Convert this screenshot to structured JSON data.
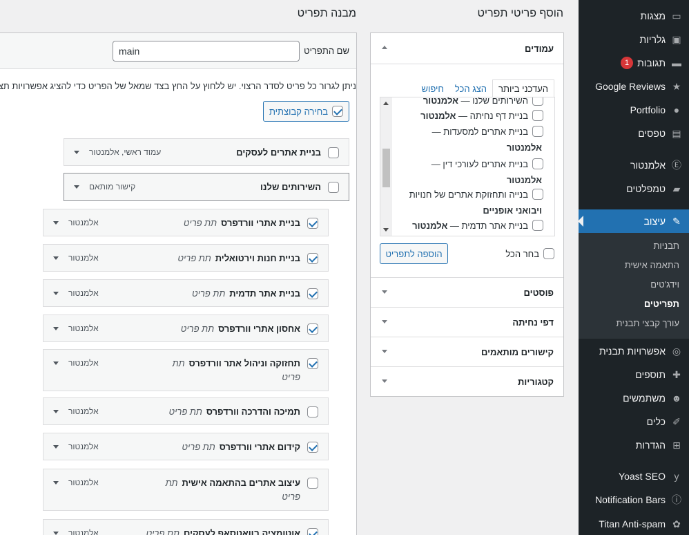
{
  "sidebar": {
    "items": [
      {
        "label": "מצגות",
        "icon": "slides-icon",
        "glyph": "▭"
      },
      {
        "label": "גלריות",
        "icon": "gallery-icon",
        "glyph": "▣"
      },
      {
        "label": "תגובות",
        "icon": "comments-icon",
        "glyph": "▬",
        "badge": "1"
      },
      {
        "label": "Google Reviews",
        "icon": "google-reviews-icon",
        "glyph": "★"
      },
      {
        "label": "Portfolio",
        "icon": "portfolio-icon",
        "glyph": "●"
      },
      {
        "label": "טפסים",
        "icon": "forms-icon",
        "glyph": "▤"
      },
      {
        "label": "אלמנטור",
        "icon": "elementor-icon",
        "glyph": "Ⓔ"
      },
      {
        "label": "טמפלטים",
        "icon": "templates-icon",
        "glyph": "▰"
      },
      {
        "label": "עיצוב",
        "icon": "appearance-icon",
        "glyph": "✎"
      },
      {
        "label": "אפשרויות תבנית",
        "icon": "theme-options-icon",
        "glyph": "◎"
      },
      {
        "label": "תוספים",
        "icon": "plugins-icon",
        "glyph": "✚"
      },
      {
        "label": "משתמשים",
        "icon": "users-icon",
        "glyph": "☻"
      },
      {
        "label": "כלים",
        "icon": "tools-icon",
        "glyph": "✐"
      },
      {
        "label": "הגדרות",
        "icon": "settings-icon",
        "glyph": "⊞"
      },
      {
        "label": "Yoast SEO",
        "icon": "yoast-icon",
        "glyph": "y"
      },
      {
        "label": "Notification Bars",
        "icon": "info-icon",
        "glyph": "ⓘ"
      },
      {
        "label": "Titan Anti-spam",
        "icon": "titan-icon",
        "glyph": "✿"
      }
    ],
    "submenu": [
      "תבניות",
      "התאמה אישית",
      "וידג'טים",
      "תפריטים",
      "עורך קבצי תבנית"
    ]
  },
  "headings": {
    "add_items": "הוסף פריטי תפריט",
    "structure": "מבנה תפריט"
  },
  "accordion": {
    "pages_title": "עמודים",
    "tabs": [
      "העדכני ביותר",
      "הצג הכל",
      "חיפוש"
    ],
    "pages": [
      {
        "text": "השירותים שלנו — ",
        "strong": "אלמנטור",
        "checkbox": true
      },
      {
        "text": "בניית דף נחיתה — ",
        "strong": "אלמנטור",
        "checkbox": true
      },
      {
        "text": "בניית אתרים למסעדות —",
        "strong": "",
        "checkbox": true
      },
      {
        "text": "",
        "strong": "אלמנטור",
        "checkbox": false
      },
      {
        "text": "בניית אתרים לעורכי דין —",
        "strong": "",
        "checkbox": true
      },
      {
        "text": "",
        "strong": "אלמנטור",
        "checkbox": false
      },
      {
        "text": "בנייה ותחזוקת אתרים של חנויות",
        "strong": "",
        "checkbox": true
      },
      {
        "text": "ויבואני אופניים",
        "strong": "",
        "checkbox": false
      },
      {
        "text": "בניית אתר תדמית — ",
        "strong": "אלמנטור",
        "checkbox": true
      }
    ],
    "select_all": "בחר הכל",
    "add_to_menu": "הוספה לתפריט",
    "sections": [
      "פוסטים",
      "דפי נחיתה",
      "קישורים מותאמים",
      "קטגוריות"
    ]
  },
  "menu": {
    "name_label": "שם התפריט",
    "name_value": "main",
    "instructions": "ניתן לגרור כל פריט לסדר הרצוי. יש ללחוץ על החץ בצד שמאל של הפריט כדי להציג אפשרויות תצורה נ",
    "bulk_select": "בחירה קבוצתית",
    "sub_item_label": "תת פריט",
    "items": [
      {
        "title": "בניית אתרים לעסקים",
        "type": "עמוד ראשי, אלמנטור",
        "checked": false,
        "sub": false
      },
      {
        "title": "השירותים שלנו",
        "type": "קישור מותאם",
        "checked": false,
        "sub": false
      },
      {
        "title": "בניית אתרי וורדפרס",
        "type": "אלמנטור",
        "checked": true,
        "sub": true
      },
      {
        "title": "בניית חנות וירטואלית",
        "type": "אלמנטור",
        "checked": true,
        "sub": true
      },
      {
        "title": "בניית אתר תדמית",
        "type": "אלמנטור",
        "checked": true,
        "sub": true
      },
      {
        "title": "אחסון אתרי וורדפרס",
        "type": "אלמנטור",
        "checked": true,
        "sub": true
      },
      {
        "title": "תחזוקה וניהול אתר וורדפרס",
        "type": "אלמנטור",
        "checked": true,
        "sub": true,
        "wrap": true
      },
      {
        "title": "תמיכה והדרכה וורדפרס",
        "type": "אלמנטור",
        "checked": false,
        "sub": true
      },
      {
        "title": "קידום אתרי וורדפרס",
        "type": "אלמנטור",
        "checked": true,
        "sub": true
      },
      {
        "title": "עיצוב אתרים בהתאמה אישית",
        "type": "אלמנטור",
        "checked": false,
        "sub": true,
        "wrap": true
      },
      {
        "title": "אוטומציה בוואטסאפ לעסקים",
        "type": "אלמנטור",
        "checked": true,
        "sub": true
      }
    ]
  }
}
